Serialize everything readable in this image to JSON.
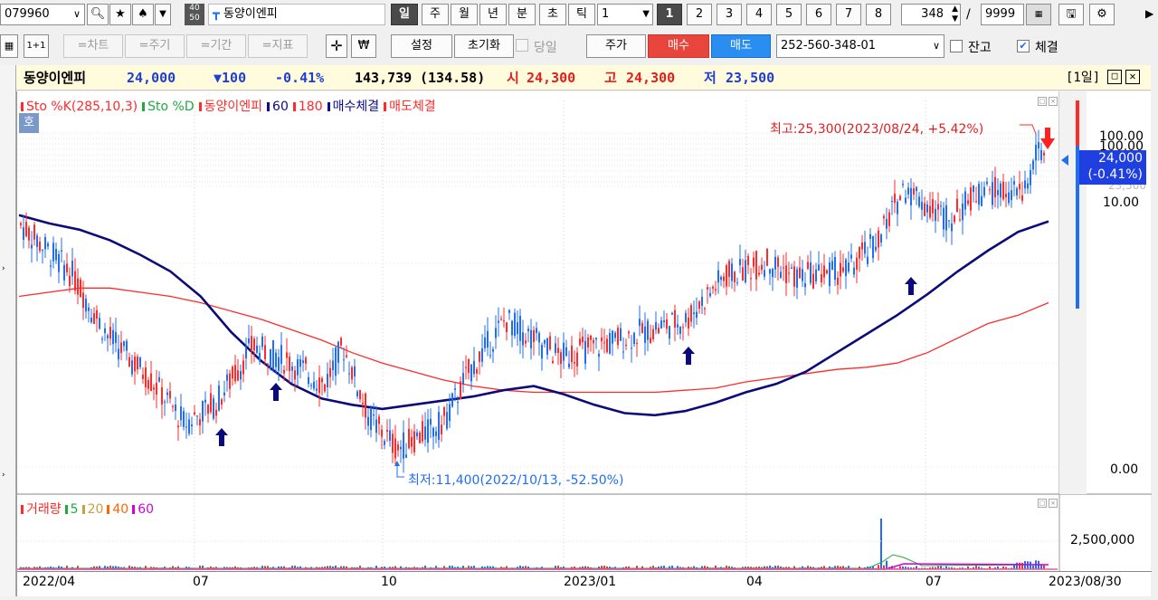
{
  "toolbar": {
    "code": "079960",
    "stock_name": "동양이엔피",
    "periods": [
      "일",
      "주",
      "월",
      "년",
      "분",
      "초",
      "틱"
    ],
    "interval_value": "1",
    "page_buttons": [
      "1",
      "2",
      "3",
      "4",
      "5",
      "6",
      "7",
      "8"
    ],
    "count_value": "348",
    "slash": "/",
    "max_count": "9999",
    "badge_top": "40",
    "badge_bottom": "50"
  },
  "toolbar2": {
    "tabs": [
      "=차트",
      "=주기",
      "=기간",
      "=지표"
    ],
    "settings": "설정",
    "reset": "초기화",
    "today": "당일",
    "price": "주가",
    "buy": "매수",
    "sell": "매도",
    "account": "252-560-348-01",
    "balance": "잔고",
    "fill": "체결",
    "one_plus_one": "1+1"
  },
  "info": {
    "name": "동양이엔피",
    "price": "24,000",
    "change": "▼100",
    "pct": "-0.41%",
    "volume": "143,739",
    "volume_ratio": "(134.58)",
    "open_label": "시",
    "open": "24,300",
    "high_label": "고",
    "high": "24,300",
    "low_label": "저",
    "low": "23,500",
    "period_label": "[1일]"
  },
  "price_panel": {
    "legend": [
      "Sto %K(285,10,3)",
      "Sto %D",
      "동양이엔피",
      "60",
      "180",
      "매수체결",
      "매도체결"
    ],
    "legend_colors": [
      "#ff2a2a",
      "#1faa3c",
      "#ff2a2a",
      "#0a0a8c",
      "#ff2a2a",
      "#0a0a8c",
      "#ff2a2a"
    ],
    "side_tag": "호",
    "high_annotation": "최고:25,300(2023/08/24, +5.42%)",
    "low_annotation": "최저:11,400(2022/10/13, -52.50%)",
    "axis_top": "100.00",
    "axis_top2": "100.00",
    "axis_mid": "10.00",
    "axis_bottom": "0.00",
    "current_price_tag": "24,000",
    "current_pct_tag": "(-0.41%)",
    "hidden_tag": "23,500"
  },
  "volume_panel": {
    "legend": [
      "거래량",
      "5",
      "20",
      "40",
      "60"
    ],
    "legend_colors": [
      "#ff2a2a",
      "#1faa3c",
      "#c8a040",
      "#ff6600",
      "#d400d4"
    ],
    "axis_label": "2,500,000"
  },
  "date_axis": [
    "2022/04",
    "07",
    "10",
    "2023/01",
    "04",
    "07",
    "2023/08/30"
  ],
  "colors": {
    "up": "#ff2a2a",
    "down": "#1f6ff0",
    "ma60": "#0a0a7a",
    "ma180": "#ff2a2a",
    "buy_arrow": "#0a0a7a",
    "sell_arrow": "#ff2020"
  },
  "chart_data": {
    "type": "candlestick",
    "ma60": [
      22.8,
      22.4,
      22.1,
      21.6,
      20.9,
      20.1,
      18.9,
      17.2,
      15.8,
      14.7,
      14.0,
      13.7,
      13.5,
      13.7,
      13.9,
      14.1,
      14.4,
      14.6,
      14.2,
      13.7,
      13.3,
      13.2,
      13.4,
      13.8,
      14.3,
      14.7,
      15.3,
      16.2,
      17.1,
      18.0,
      19.0,
      20.1,
      21.1,
      22.0,
      22.5
    ],
    "ma180": [
      18.9,
      19.1,
      19.3,
      19.3,
      19.1,
      18.9,
      18.6,
      18.2,
      17.8,
      17.3,
      16.8,
      16.2,
      15.7,
      15.3,
      14.9,
      14.6,
      14.4,
      14.3,
      14.3,
      14.3,
      14.3,
      14.3,
      14.4,
      14.5,
      14.8,
      15.0,
      15.2,
      15.4,
      15.5,
      15.7,
      16.2,
      16.9,
      17.6,
      18.0,
      18.6
    ]
  }
}
